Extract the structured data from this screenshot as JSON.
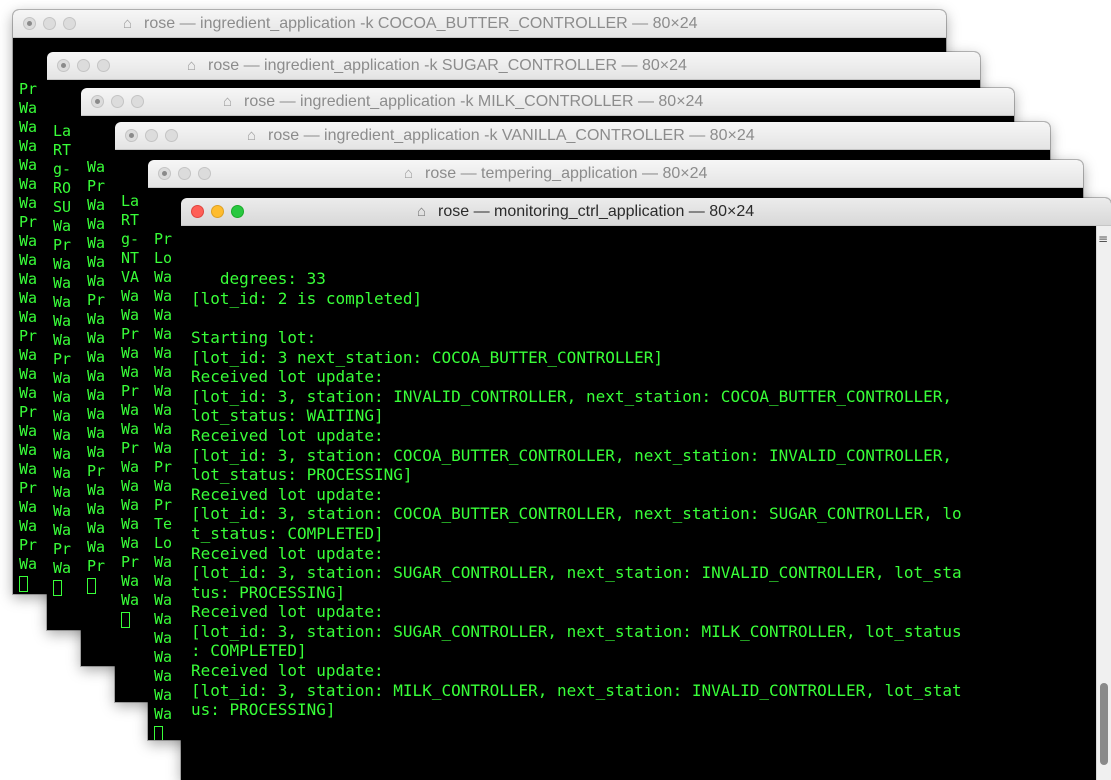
{
  "windows": [
    {
      "title": "rose — ingredient_application -k COCOA_BUTTER_CONTROLLER — 80×24",
      "fragments": [
        "Pr",
        "Wa",
        "Wa",
        "Wa",
        "Wa",
        "Wa",
        "Wa",
        "Pr",
        "Wa",
        "Wa",
        "Wa",
        "Wa",
        "Wa",
        "Pr",
        "Wa",
        "Wa",
        "Wa",
        "Pr",
        "Wa",
        "Wa",
        "Wa",
        "Pr",
        "Wa",
        "Wa",
        "Pr",
        "Wa"
      ]
    },
    {
      "title": "rose — ingredient_application -k SUGAR_CONTROLLER — 80×24",
      "fragments": [
        "La",
        "RT",
        "g-",
        "RO",
        "SU",
        "Wa",
        "Pr",
        "Wa",
        "Wa",
        "Wa",
        "Wa",
        "Wa",
        "Pr",
        "Wa",
        "Wa",
        "Wa",
        "Wa",
        "Wa",
        "Wa",
        "Wa",
        "Wa",
        "Wa",
        "Pr",
        "Wa"
      ]
    },
    {
      "title": "rose — ingredient_application -k MILK_CONTROLLER — 80×24",
      "fragments": [
        "Wa",
        "Pr",
        "Wa",
        "Wa",
        "Wa",
        "Wa",
        "Wa",
        "Pr",
        "Wa",
        "Wa",
        "Wa",
        "Wa",
        "Wa",
        "Wa",
        "Wa",
        "Wa",
        "Pr",
        "Wa",
        "Wa",
        "Wa",
        "Wa",
        "Pr"
      ]
    },
    {
      "title": "rose — ingredient_application -k VANILLA_CONTROLLER — 80×24",
      "fragments": [
        "La",
        "RT",
        "g-",
        "NT",
        "VA",
        "Wa",
        "Wa",
        "Pr",
        "Wa",
        "Wa",
        "Pr",
        "Wa",
        "Wa",
        "Pr",
        "Wa",
        "Wa",
        "Wa",
        "Wa",
        "Wa",
        "Pr",
        "Wa",
        "Wa"
      ]
    },
    {
      "title": "rose — tempering_application — 80×24",
      "fragments": [
        "Pr",
        "Lo",
        "Wa",
        "Wa",
        "Wa",
        "Wa",
        "Wa",
        "Wa",
        "Wa",
        "Wa",
        "Wa",
        "Wa",
        "Pr",
        "Wa",
        "Pr",
        "Te",
        "Lo",
        "Wa",
        "Wa",
        "Wa",
        "Wa",
        "Wa",
        "Wa",
        "Wa",
        "Wa",
        "Wa"
      ]
    }
  ],
  "main_window": {
    "title": "rose — monitoring_ctrl_application — 80×24",
    "lines": [
      "   degrees: 33",
      "[lot_id: 2 is completed]",
      "",
      "Starting lot:",
      "[lot_id: 3 next_station: COCOA_BUTTER_CONTROLLER]",
      "Received lot update:",
      "[lot_id: 3, station: INVALID_CONTROLLER, next_station: COCOA_BUTTER_CONTROLLER,",
      "lot_status: WAITING]",
      "Received lot update:",
      "[lot_id: 3, station: COCOA_BUTTER_CONTROLLER, next_station: INVALID_CONTROLLER,",
      "lot_status: PROCESSING]",
      "Received lot update:",
      "[lot_id: 3, station: COCOA_BUTTER_CONTROLLER, next_station: SUGAR_CONTROLLER, lo",
      "t_status: COMPLETED]",
      "Received lot update:",
      "[lot_id: 3, station: SUGAR_CONTROLLER, next_station: INVALID_CONTROLLER, lot_sta",
      "tus: PROCESSING]",
      "Received lot update:",
      "[lot_id: 3, station: SUGAR_CONTROLLER, next_station: MILK_CONTROLLER, lot_status",
      ": COMPLETED]",
      "Received lot update:",
      "[lot_id: 3, station: MILK_CONTROLLER, next_station: INVALID_CONTROLLER, lot_stat",
      "us: PROCESSING]"
    ],
    "scroll_mark": "≡"
  },
  "icons": {
    "home": "home-icon",
    "cursor": "terminal-cursor"
  },
  "colors": {
    "terminal_text": "#39ff39",
    "terminal_bg": "#000000",
    "close": "#fe5f57",
    "minimize": "#febc2e",
    "zoom": "#28c840"
  }
}
